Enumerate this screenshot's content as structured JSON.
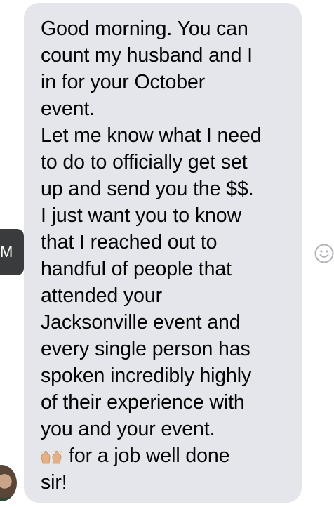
{
  "message": {
    "lines": [
      "Good morning. You can",
      "count my husband and I",
      "in for your October",
      "event.",
      "Let me know what I need",
      "to do to officially get set",
      "up and send you the $$.",
      "I just want you to know",
      "that I reached out to",
      "handful of people that",
      "attended your",
      "Jacksonville event and",
      "every single person has",
      "spoken incredibly highly",
      "of their experience with",
      "you and your event.",
      "for a  job well done",
      "sir!"
    ],
    "emoji": "raised-hands"
  },
  "timestamp_tab": {
    "label": "M"
  },
  "reaction_button": {
    "icon": "smiley-face-icon"
  }
}
